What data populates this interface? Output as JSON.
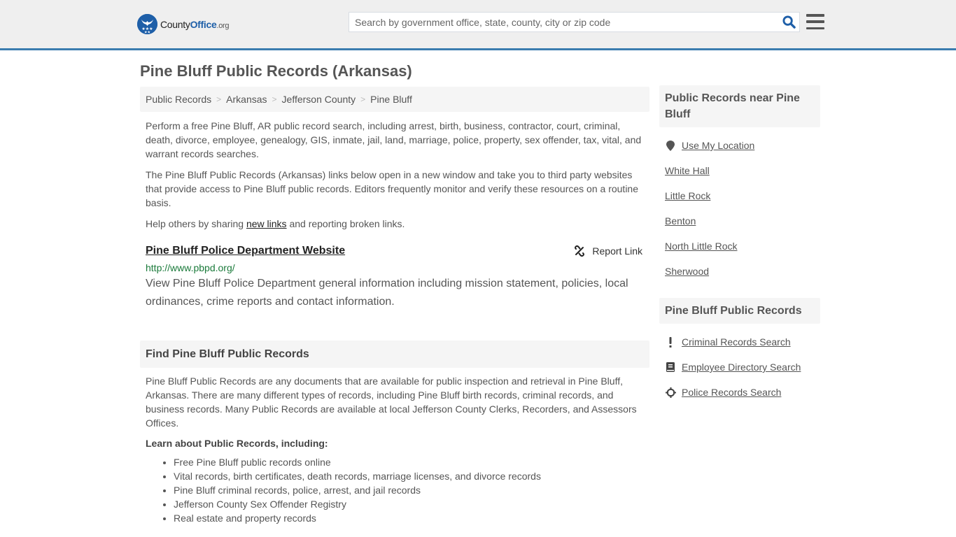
{
  "header": {
    "logo": {
      "prefix": "County",
      "brand": "Office",
      "tld": ".org",
      "icon": "eagle-stars-badge-icon"
    },
    "search": {
      "placeholder": "Search by government office, state, county, city or zip code",
      "value": "",
      "icon": "search-icon"
    },
    "menu_icon": "hamburger-menu-icon"
  },
  "colors": {
    "accent": "#3a7caf",
    "brand_blue": "#1e5fa8",
    "url_green": "#1a7a3a",
    "panel_bg": "#f5f5f5",
    "header_bg": "#efefef",
    "text": "#555555"
  },
  "page": {
    "title": "Pine Bluff Public Records (Arkansas)"
  },
  "breadcrumb": [
    {
      "label": "Public Records"
    },
    {
      "label": "Arkansas"
    },
    {
      "label": "Jefferson County"
    },
    {
      "label": "Pine Bluff"
    }
  ],
  "breadcrumb_separator": ">",
  "intro": {
    "p1": "Perform a free Pine Bluff, AR public record search, including arrest, birth, business, contractor, court, criminal, death, divorce, employee, genealogy, GIS, inmate, jail, land, marriage, police, property, sex offender, tax, vital, and warrant records searches.",
    "p2": "The Pine Bluff Public Records (Arkansas) links below open in a new window and take you to third party websites that provide access to Pine Bluff public records. Editors frequently monitor and verify these resources on a routine basis.",
    "p3_before": "Help others by sharing ",
    "p3_link": "new links",
    "p3_after": " and reporting broken links."
  },
  "records": [
    {
      "title": "Pine Bluff Police Department Website",
      "url": "http://www.pbpd.org/",
      "description": "View Pine Bluff Police Department general information including mission statement, policies, local ordinances, crime reports and contact information.",
      "report_label": "Report Link",
      "report_icon": "broken-link-icon"
    }
  ],
  "find_section": {
    "heading": "Find Pine Bluff Public Records",
    "body": "Pine Bluff Public Records are any documents that are available for public inspection and retrieval in Pine Bluff, Arkansas. There are many different types of records, including Pine Bluff birth records, criminal records, and business records. Many Public Records are available at local Jefferson County Clerks, Recorders, and Assessors Offices.",
    "subheading": "Learn about Public Records, including:",
    "items": [
      "Free Pine Bluff public records online",
      "Vital records, birth certificates, death records, marriage licenses, and divorce records",
      "Pine Bluff criminal records, police, arrest, and jail records",
      "Jefferson County Sex Offender Registry",
      "Real estate and property records"
    ]
  },
  "sidebar": {
    "nearby": {
      "heading": "Public Records near Pine Bluff",
      "use_location": {
        "label": "Use My Location",
        "icon": "map-marker-icon"
      },
      "links": [
        "White Hall",
        "Little Rock",
        "Benton",
        "North Little Rock",
        "Sherwood"
      ]
    },
    "city_records": {
      "heading": "Pine Bluff Public Records",
      "links": [
        {
          "label": "Criminal Records Search",
          "icon": "exclamation-icon"
        },
        {
          "label": "Employee Directory Search",
          "icon": "book-icon"
        },
        {
          "label": "Police Records Search",
          "icon": "crosshairs-icon"
        }
      ]
    }
  }
}
